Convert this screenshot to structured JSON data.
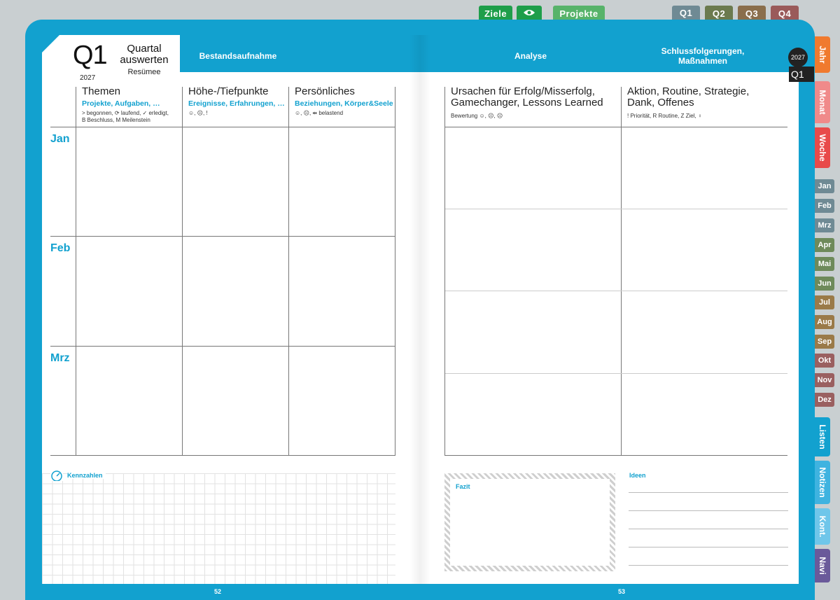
{
  "top_tabs": [
    {
      "label": "Ziele",
      "color": "#1e9e4a"
    },
    {
      "label": "eye",
      "color": "#1e9e4a"
    },
    {
      "label": "Projekte",
      "color": "#57b36a"
    },
    {
      "label": "Q1",
      "color": "#6f8a94"
    },
    {
      "label": "Q2",
      "color": "#6b7a4e"
    },
    {
      "label": "Q3",
      "color": "#8a6e4c"
    },
    {
      "label": "Q4",
      "color": "#9a5a5a"
    }
  ],
  "header": {
    "quarter": "Q1",
    "year": "2027",
    "title_line1": "Quartal",
    "title_line2": "auswerten",
    "subtitle": "Resümee",
    "left_band": "Bestandsaufnahme",
    "mid_band": "Analyse",
    "right_band_line1": "Schlussfolgerungen,",
    "right_band_line2": "Maßnahmen"
  },
  "left_columns": [
    {
      "title": "Themen",
      "sub": "Projekte, Aufgaben, …",
      "note1": "> begonnen, ⟳ laufend, ✓ erledigt,",
      "note2": "B Beschluss, M Meilenstein"
    },
    {
      "title": "Höhe-/Tiefpunkte",
      "sub": "Ereignisse, Erfahrungen, …",
      "note1": "☺, ☹, !",
      "note2": ""
    },
    {
      "title": "Persönliches",
      "sub": "Beziehungen, Körper&Seele",
      "note1": "☺, ☹, ⇹ belastend",
      "note2": ""
    }
  ],
  "right_columns": [
    {
      "title_line1": "Ursachen für Erfolg/Misserfolg,",
      "title_line2": "Gamechanger, Lessons Learned",
      "note": "Bewertung ☺, ☹, ☹"
    },
    {
      "title_line1": "Aktion, Routine, Strategie,",
      "title_line2": "Dank, Offenes",
      "note": "! Priorität, R Routine, Z Ziel, ♀"
    }
  ],
  "months": [
    "Jan",
    "Feb",
    "Mrz"
  ],
  "bottom": {
    "kennzahlen": "Kennzahlen",
    "fazit": "Fazit",
    "ideen": "Ideen"
  },
  "page_numbers": {
    "left": "52",
    "right": "53"
  },
  "side": {
    "year": "2027",
    "quarter": "Q1",
    "tabs": [
      {
        "label": "Jahr",
        "color": "#f07a2e"
      },
      {
        "label": "Monat",
        "color": "#f08a8a"
      },
      {
        "label": "Woche",
        "color": "#e84a4a"
      }
    ],
    "month_tabs": [
      {
        "label": "Jan",
        "color": "#6f8a94"
      },
      {
        "label": "Feb",
        "color": "#6f8a94"
      },
      {
        "label": "Mrz",
        "color": "#6f8a94"
      },
      {
        "label": "Apr",
        "color": "#6e8a5a"
      },
      {
        "label": "Mai",
        "color": "#6e8a5a"
      },
      {
        "label": "Jun",
        "color": "#6e8a5a"
      },
      {
        "label": "Jul",
        "color": "#9a7a48"
      },
      {
        "label": "Aug",
        "color": "#9a7a48"
      },
      {
        "label": "Sep",
        "color": "#9a7a48"
      },
      {
        "label": "Okt",
        "color": "#9a6060"
      },
      {
        "label": "Nov",
        "color": "#9a6060"
      },
      {
        "label": "Dez",
        "color": "#9a6060"
      }
    ],
    "lower_tabs": [
      {
        "label": "Listen",
        "color": "#12a1cf"
      },
      {
        "label": "Notizen",
        "color": "#3fb3e0"
      },
      {
        "label": "Kont.",
        "color": "#6fc6ea"
      },
      {
        "label": "Navi",
        "color": "#6a5a9a"
      }
    ]
  }
}
